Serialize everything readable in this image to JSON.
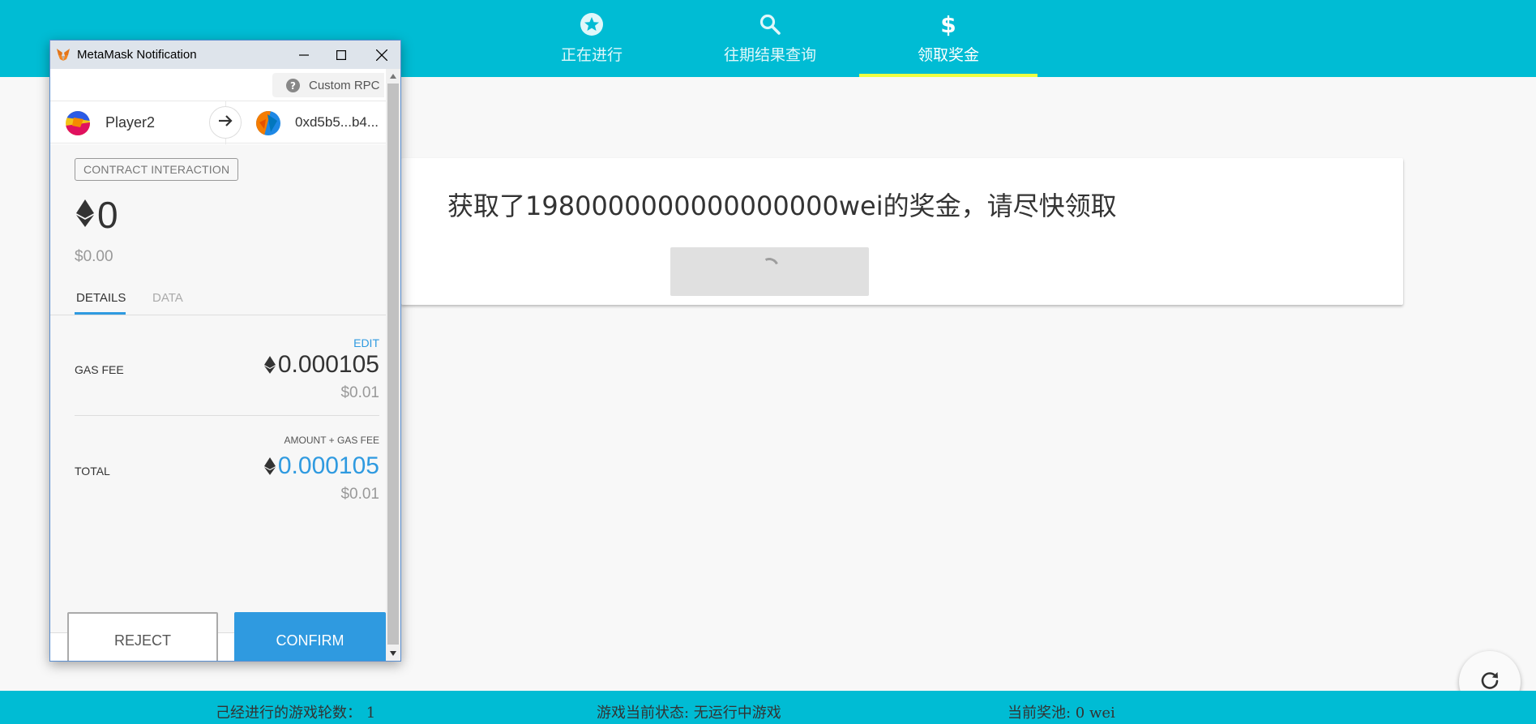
{
  "nav": {
    "tabs": [
      {
        "label": "正在进行",
        "icon": "star-circle-icon"
      },
      {
        "label": "往期结果查询",
        "icon": "search-icon"
      },
      {
        "label": "领取奖金",
        "icon": "dollar-icon",
        "active": true
      }
    ]
  },
  "card": {
    "message": "获取了1980000000000000000wei的奖金，请尽快领取"
  },
  "footer": {
    "rounds": "己经进行的游戏轮数： 1",
    "status": "游戏当前状态: 无运行中游戏",
    "pool": "当前奖池: 0 wei"
  },
  "metamask": {
    "window_title": "MetaMask Notification",
    "network": "Custom RPC",
    "from_account": "Player2",
    "to_account": "0xd5b5...b4...",
    "badge": "CONTRACT INTERACTION",
    "amount": "0",
    "amount_fiat": "$0.00",
    "tabs": [
      "DETAILS",
      "DATA"
    ],
    "edit_label": "EDIT",
    "gas_fee_label": "GAS FEE",
    "gas_fee_value": "0.000105",
    "gas_fee_fiat": "$0.01",
    "sum_label": "AMOUNT + GAS FEE",
    "total_label": "TOTAL",
    "total_value": "0.000105",
    "total_fiat": "$0.01",
    "reject_label": "REJECT",
    "confirm_label": "CONFIRM"
  },
  "colors": {
    "primary": "#00bcd4",
    "accent_underline": "#eeff41",
    "metamask_blue": "#2f9ae0"
  }
}
